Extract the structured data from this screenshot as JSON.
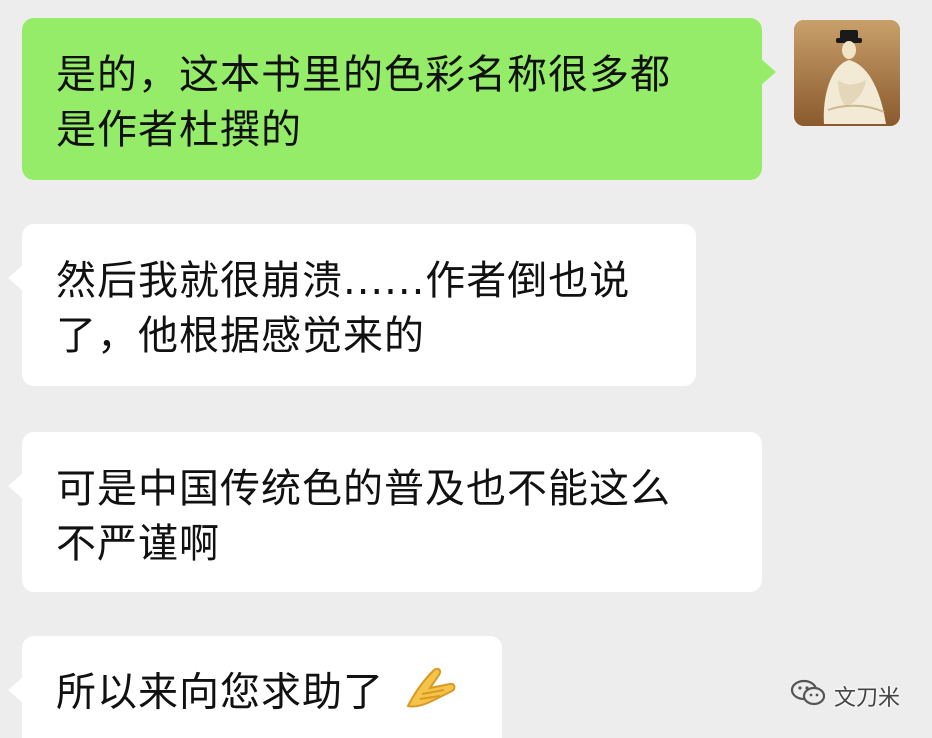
{
  "messages": [
    {
      "side": "sent",
      "lines": [
        "是的，这本书里的色彩名称很多都",
        "是作者杜撰的"
      ]
    },
    {
      "side": "received",
      "lines": [
        "然后我就很崩溃......作者倒也说",
        "了，他根据感觉来的"
      ]
    },
    {
      "side": "received",
      "lines": [
        "可是中国传统色的普及也不能这么",
        "不严谨啊"
      ]
    },
    {
      "side": "received",
      "lines": [
        "所以来向您求助了"
      ],
      "emoji": "folded-hands-icon"
    }
  ],
  "watermark": {
    "text": "文刀米",
    "icon": "wechat-official-account-icon"
  },
  "colors": {
    "background": "#ededed",
    "sent_bubble": "#95ec69",
    "received_bubble": "#ffffff"
  }
}
